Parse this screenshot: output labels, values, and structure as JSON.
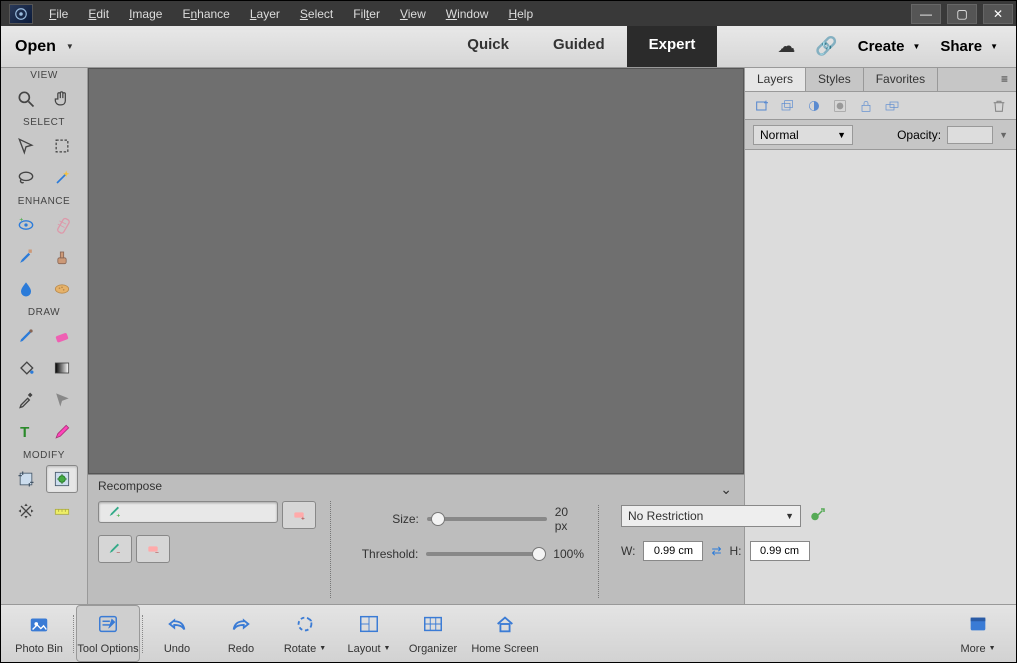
{
  "menubar": [
    "File",
    "Edit",
    "Image",
    "Enhance",
    "Layer",
    "Select",
    "Filter",
    "View",
    "Window",
    "Help"
  ],
  "open_label": "Open",
  "modes": {
    "quick": "Quick",
    "guided": "Guided",
    "expert": "Expert"
  },
  "topright": {
    "create": "Create",
    "share": "Share"
  },
  "toolbox": {
    "view": "VIEW",
    "select": "SELECT",
    "enhance": "ENHANCE",
    "draw": "DRAW",
    "modify": "MODIFY"
  },
  "options": {
    "title": "Recompose",
    "size_label": "Size:",
    "size_value": "20 px",
    "threshold_label": "Threshold:",
    "threshold_value": "100%",
    "preset": "No Restriction",
    "w_label": "W:",
    "w_value": "0.99 cm",
    "h_label": "H:",
    "h_value": "0.99 cm"
  },
  "panels": {
    "tabs": {
      "layers": "Layers",
      "styles": "Styles",
      "favorites": "Favorites"
    },
    "blend": "Normal",
    "opacity_label": "Opacity:"
  },
  "bottom": {
    "photobin": "Photo Bin",
    "toolopt": "Tool Options",
    "undo": "Undo",
    "redo": "Redo",
    "rotate": "Rotate",
    "layout": "Layout",
    "organizer": "Organizer",
    "home": "Home Screen",
    "more": "More"
  }
}
